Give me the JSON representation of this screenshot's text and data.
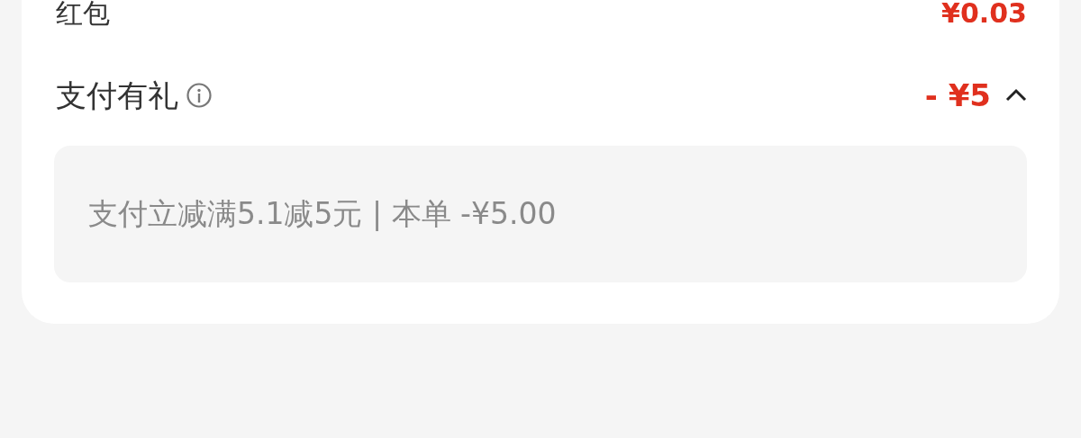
{
  "rows": [
    {
      "label": "红包",
      "amount": "¥0.03"
    },
    {
      "label": "支付有礼",
      "amount": "- ¥5",
      "info": true,
      "expanded": true,
      "detail": "支付立减满5.1减5元 | 本单 -¥5.00"
    }
  ]
}
